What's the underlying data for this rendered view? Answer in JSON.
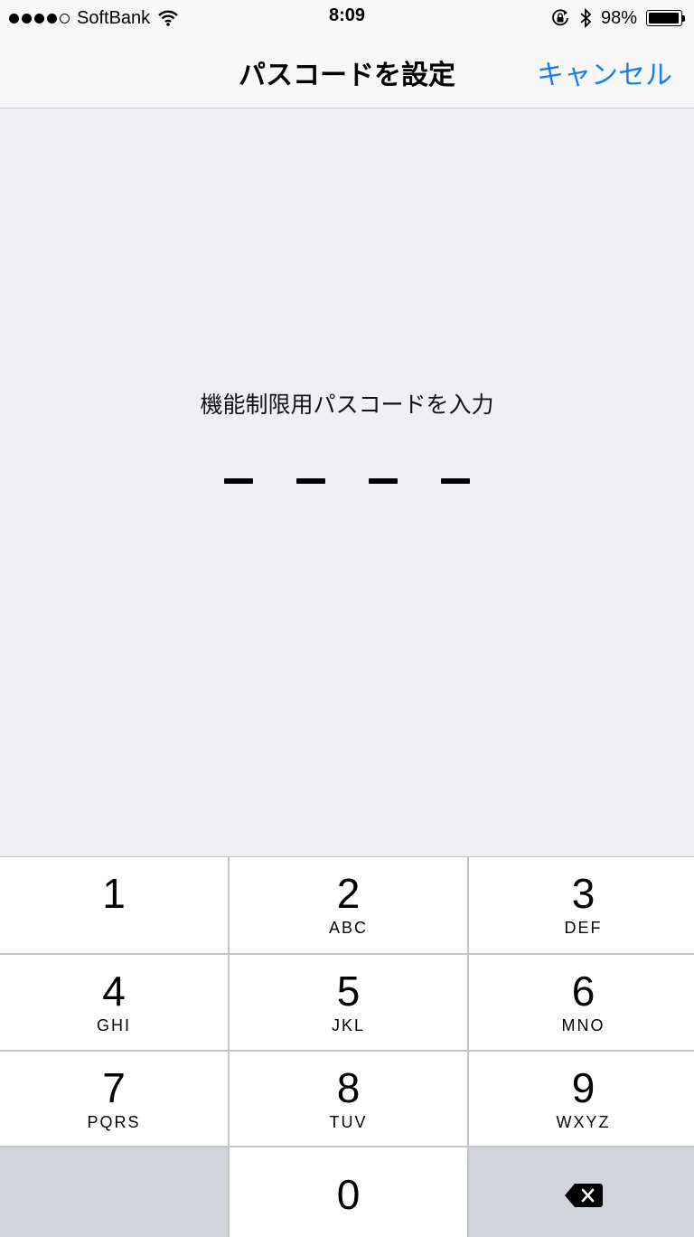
{
  "status_bar": {
    "carrier": "SoftBank",
    "time": "8:09",
    "battery_percent": "98%",
    "battery_level": 0.98,
    "signal_bars": 4,
    "icons": [
      "wifi-icon",
      "rotation-lock-icon",
      "bluetooth-icon",
      "battery-icon"
    ]
  },
  "nav": {
    "title": "パスコードを設定",
    "cancel_label": "キャンセル",
    "accent_color": "#1a7cf5"
  },
  "prompt": {
    "text": "機能制限用パスコードを入力",
    "slots": 4
  },
  "keypad": {
    "keys": [
      {
        "digit": "1",
        "letters": ""
      },
      {
        "digit": "2",
        "letters": "ABC"
      },
      {
        "digit": "3",
        "letters": "DEF"
      },
      {
        "digit": "4",
        "letters": "GHI"
      },
      {
        "digit": "5",
        "letters": "JKL"
      },
      {
        "digit": "6",
        "letters": "MNO"
      },
      {
        "digit": "7",
        "letters": "PQRS"
      },
      {
        "digit": "8",
        "letters": "TUV"
      },
      {
        "digit": "9",
        "letters": "WXYZ"
      },
      {
        "digit": "0",
        "letters": ""
      }
    ],
    "delete_icon": "backspace-icon"
  }
}
